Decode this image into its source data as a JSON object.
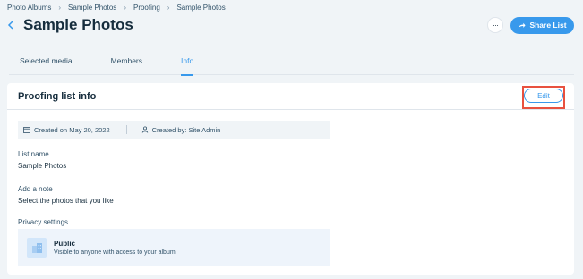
{
  "breadcrumb": [
    "Photo Albums",
    "Sample Photos",
    "Proofing",
    "Sample Photos"
  ],
  "header": {
    "title": "Sample Photos",
    "more_label": "···",
    "share_label": "Share List"
  },
  "tabs": [
    {
      "label": "Selected media",
      "active": false
    },
    {
      "label": "Members",
      "active": false
    },
    {
      "label": "Info",
      "active": true
    }
  ],
  "card": {
    "title": "Proofing list info",
    "edit_label": "Edit",
    "created_on": "Created on May 20, 2022",
    "created_by": "Created by: Site Admin",
    "list_name_label": "List name",
    "list_name_value": "Sample Photos",
    "note_label": "Add a note",
    "note_value": "Select the photos that you like",
    "privacy_label": "Privacy settings",
    "privacy_title": "Public",
    "privacy_desc": "Visible to anyone with access to your album."
  },
  "icons": {
    "back": "chevron-left-icon",
    "share": "share-icon",
    "calendar": "calendar-icon",
    "user": "user-icon",
    "privacy": "building-icon"
  },
  "colors": {
    "accent": "#3899ec",
    "highlight": "#e8513f",
    "background": "#f0f4f7"
  }
}
